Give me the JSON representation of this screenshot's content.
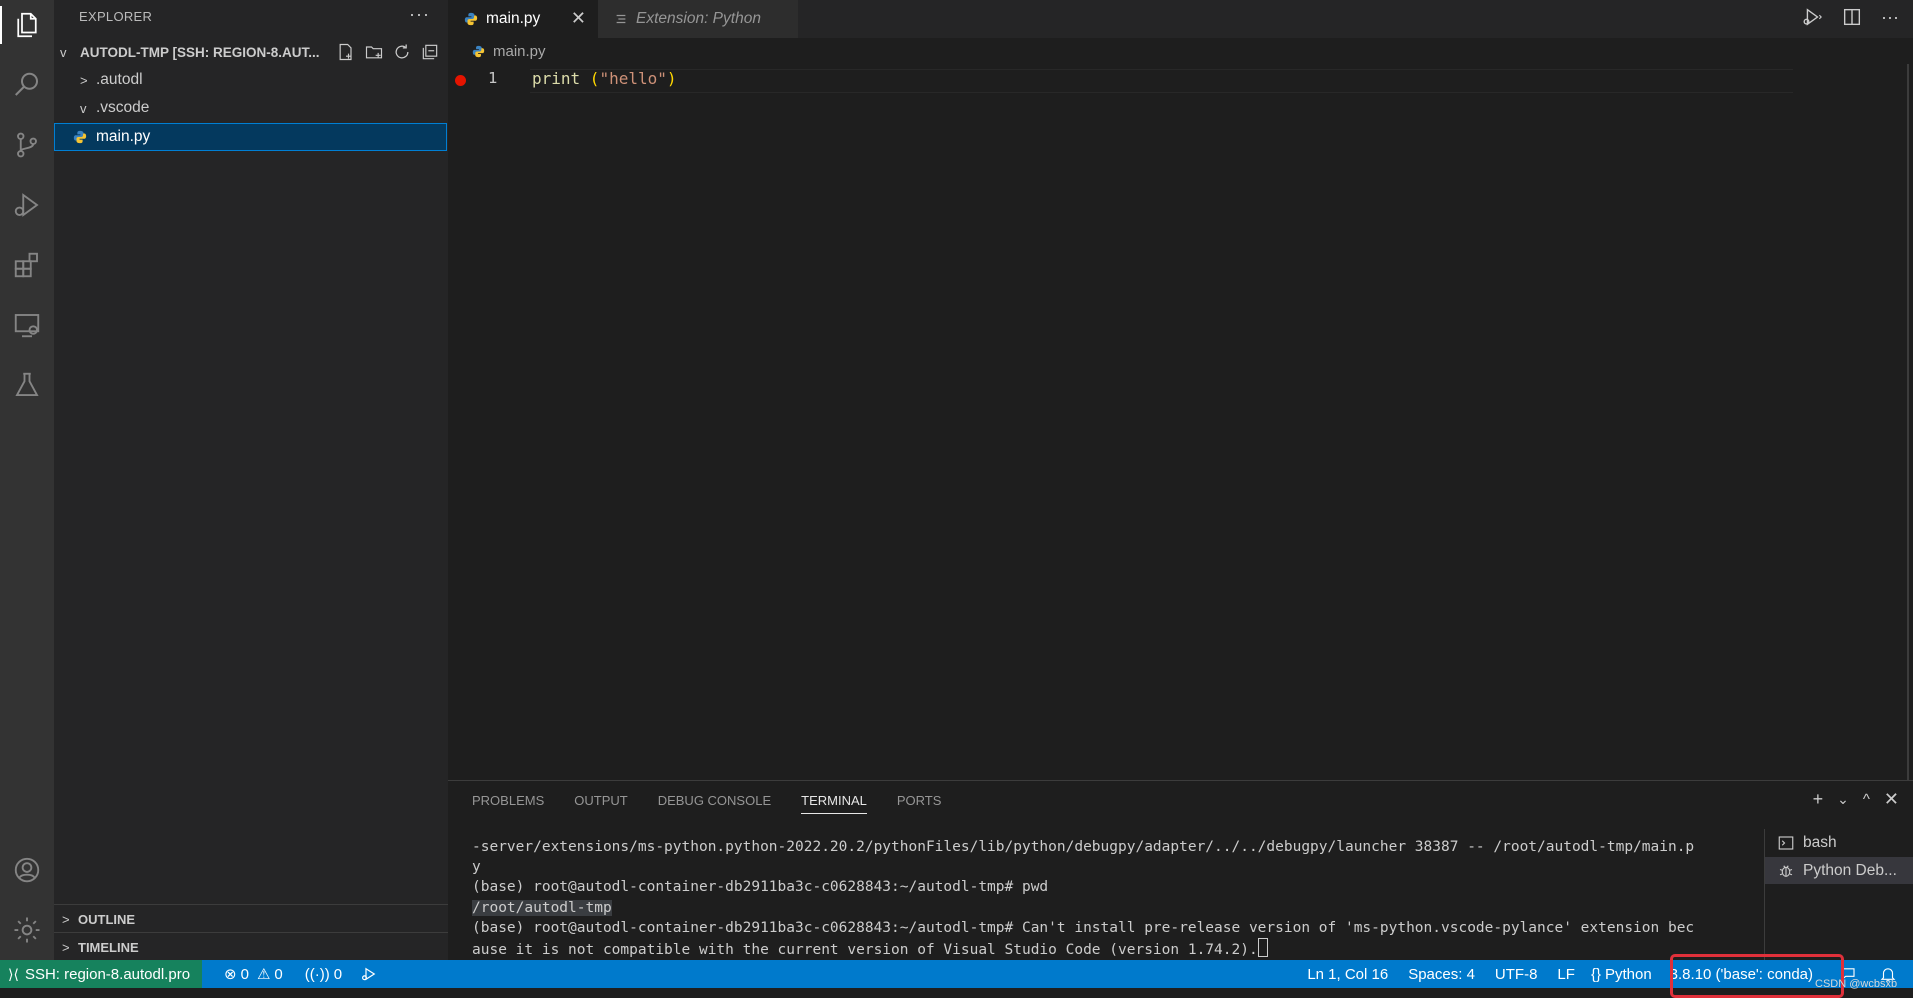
{
  "sidebar": {
    "title": "EXPLORER",
    "more": "···",
    "folder": "AUTODL-TMP [SSH: REGION-8.AUT...",
    "items": [
      {
        "label": ".autodl",
        "chevron": ">"
      },
      {
        "label": ".vscode",
        "chevron": "v"
      },
      {
        "label": "main.py"
      }
    ],
    "sections": [
      {
        "label": "OUTLINE"
      },
      {
        "label": "TIMELINE"
      }
    ]
  },
  "tabs": [
    {
      "label": "main.py",
      "close": "✕"
    },
    {
      "label": "Extension: Python"
    }
  ],
  "breadcrumb": "main.py",
  "editor": {
    "line_number": "1",
    "code": {
      "fn": "print ",
      "open": "(",
      "str": "\"hello\"",
      "close": ")"
    }
  },
  "panel": {
    "tabs": [
      "PROBLEMS",
      "OUTPUT",
      "DEBUG CONSOLE",
      "TERMINAL",
      "PORTS"
    ],
    "actions": {
      "add": "+",
      "dropdown": "⌄",
      "maximize": "^",
      "close": "✕"
    },
    "terminal_lines": [
      "-server/extensions/ms-python.python-2022.20.2/pythonFiles/lib/python/debugpy/adapter/../../debugpy/launcher 38387 -- /root/autodl-tmp/main.p",
      "y",
      "(base) root@autodl-container-db2911ba3c-c0628843:~/autodl-tmp# pwd",
      "/root/autodl-tmp",
      "(base) root@autodl-container-db2911ba3c-c0628843:~/autodl-tmp# Can't install pre-release version of 'ms-python.vscode-pylance' extension bec",
      "ause it is not compatible with the current version of Visual Studio Code (version 1.74.2)."
    ],
    "terminals": [
      {
        "label": "bash"
      },
      {
        "label": "Python Deb..."
      }
    ]
  },
  "status": {
    "remote": "SSH: region-8.autodl.pro",
    "errors": "0",
    "warnings": "0",
    "ports": "0",
    "position": "Ln 1, Col 16",
    "spaces": "Spaces: 4",
    "encoding": "UTF-8",
    "eol": "LF",
    "language": "Python",
    "interpreter": "3.8.10 ('base': conda)"
  },
  "watermark": "CSDN @wcbsxb",
  "colors": {
    "statusbar": "#007acc",
    "remote": "#16825d",
    "highlight": "#e0303a",
    "breakpoint": "#e51400"
  }
}
